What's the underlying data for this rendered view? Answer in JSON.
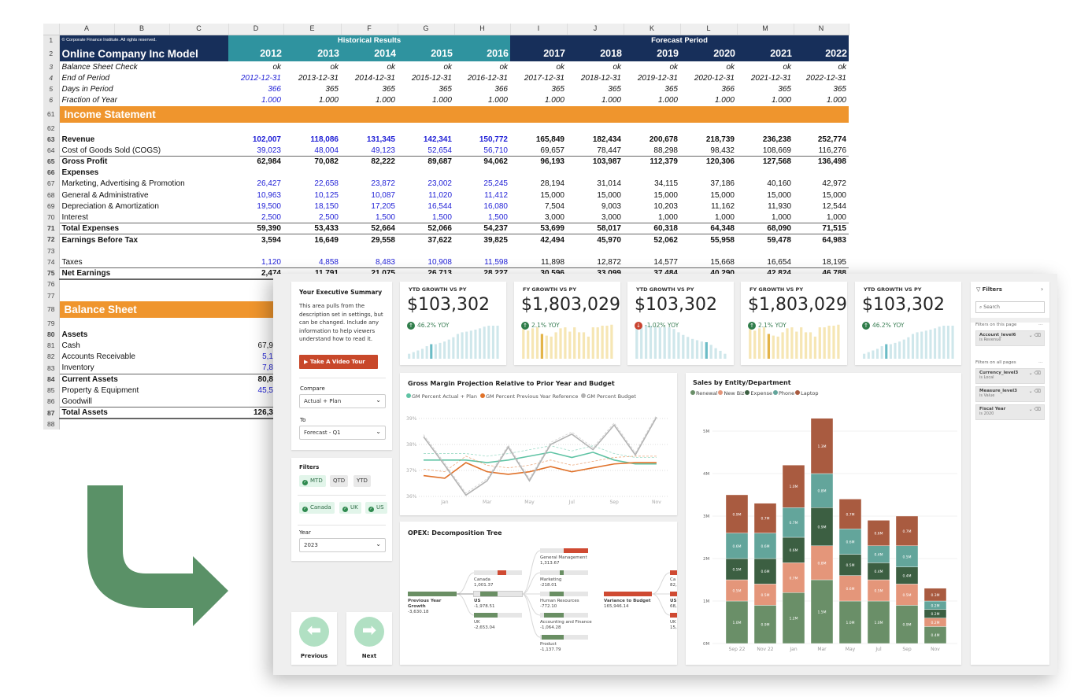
{
  "sheet": {
    "columns": [
      "A",
      "B",
      "C",
      "D",
      "E",
      "F",
      "G",
      "H",
      "I",
      "J",
      "K",
      "L",
      "M",
      "N"
    ],
    "copyright": "© Corporate Finance Institute. All rights reserved.",
    "title": "Online Company Inc Model",
    "historical_label": "Historical Results",
    "forecast_label": "Forecast Period",
    "years": [
      "2012",
      "2013",
      "2014",
      "2015",
      "2016",
      "2017",
      "2018",
      "2019",
      "2020",
      "2021",
      "2022"
    ],
    "rows": [
      {
        "num": "3",
        "label": "Balance Sheet Check",
        "style": "ital",
        "values": [
          "ok",
          "ok",
          "ok",
          "ok",
          "ok",
          "ok",
          "ok",
          "ok",
          "ok",
          "ok",
          "ok"
        ]
      },
      {
        "num": "4",
        "label": "End of Period",
        "style": "ital",
        "blue_first": true,
        "values": [
          "2012-12-31",
          "2013-12-31",
          "2014-12-31",
          "2015-12-31",
          "2016-12-31",
          "2017-12-31",
          "2018-12-31",
          "2019-12-31",
          "2020-12-31",
          "2021-12-31",
          "2022-12-31"
        ]
      },
      {
        "num": "5",
        "label": "Days in Period",
        "style": "ital",
        "blue_first": true,
        "values": [
          "366",
          "365",
          "365",
          "365",
          "366",
          "365",
          "365",
          "365",
          "366",
          "365",
          "365"
        ]
      },
      {
        "num": "6",
        "label": "Fraction of Year",
        "style": "ital",
        "blue_first": true,
        "values": [
          "1.000",
          "1.000",
          "1.000",
          "1.000",
          "1.000",
          "1.000",
          "1.000",
          "1.000",
          "1.000",
          "1.000",
          "1.000"
        ]
      },
      {
        "num": "61",
        "label": "Income Statement",
        "style": "orange",
        "values": []
      },
      {
        "num": "62",
        "label": "",
        "values": []
      },
      {
        "num": "63",
        "label": "Revenue",
        "style": "bold",
        "blue_hist": true,
        "values": [
          "102,007",
          "118,086",
          "131,345",
          "142,341",
          "150,772",
          "165,849",
          "182,434",
          "200,678",
          "218,739",
          "236,238",
          "252,774"
        ]
      },
      {
        "num": "64",
        "label": "Cost of Goods Sold (COGS)",
        "blue_hist": true,
        "values": [
          "39,023",
          "48,004",
          "49,123",
          "52,654",
          "56,710",
          "69,657",
          "78,447",
          "88,298",
          "98,432",
          "108,669",
          "116,276"
        ]
      },
      {
        "num": "65",
        "label": "Gross Profit",
        "style": "bold topb",
        "values": [
          "62,984",
          "70,082",
          "82,222",
          "89,687",
          "94,062",
          "96,193",
          "103,987",
          "112,379",
          "120,306",
          "127,568",
          "136,498"
        ]
      },
      {
        "num": "66",
        "label": "Expenses",
        "style": "bold",
        "values": []
      },
      {
        "num": "67",
        "label": "Marketing, Advertising & Promotion",
        "blue_hist": true,
        "values": [
          "26,427",
          "22,658",
          "23,872",
          "23,002",
          "25,245",
          "28,194",
          "31,014",
          "34,115",
          "37,186",
          "40,160",
          "42,972"
        ]
      },
      {
        "num": "68",
        "label": "General & Administrative",
        "blue_hist": true,
        "values": [
          "10,963",
          "10,125",
          "10,087",
          "11,020",
          "11,412",
          "15,000",
          "15,000",
          "15,000",
          "15,000",
          "15,000",
          "15,000"
        ]
      },
      {
        "num": "69",
        "label": "Depreciation & Amortization",
        "blue_hist": true,
        "values": [
          "19,500",
          "18,150",
          "17,205",
          "16,544",
          "16,080",
          "7,504",
          "9,003",
          "10,203",
          "11,162",
          "11,930",
          "12,544"
        ]
      },
      {
        "num": "70",
        "label": "Interest",
        "blue_hist": true,
        "values": [
          "2,500",
          "2,500",
          "1,500",
          "1,500",
          "1,500",
          "3,000",
          "3,000",
          "1,000",
          "1,000",
          "1,000",
          "1,000"
        ]
      },
      {
        "num": "71",
        "label": "Total Expenses",
        "style": "bold topb",
        "values": [
          "59,390",
          "53,433",
          "52,664",
          "52,066",
          "54,237",
          "53,699",
          "58,017",
          "60,318",
          "64,348",
          "68,090",
          "71,515"
        ]
      },
      {
        "num": "72",
        "label": "Earnings Before Tax",
        "style": "bold topb",
        "values": [
          "3,594",
          "16,649",
          "29,558",
          "37,622",
          "39,825",
          "42,494",
          "45,970",
          "52,062",
          "55,958",
          "59,478",
          "64,983"
        ]
      },
      {
        "num": "73",
        "label": "",
        "values": []
      },
      {
        "num": "74",
        "label": "Taxes",
        "blue_hist": true,
        "values": [
          "1,120",
          "4,858",
          "8,483",
          "10,908",
          "11,598",
          "11,898",
          "12,872",
          "14,577",
          "15,668",
          "16,654",
          "18,195"
        ]
      },
      {
        "num": "75",
        "label": "Net Earnings",
        "style": "bold topb botb",
        "values": [
          "2,474",
          "11,791",
          "21,075",
          "26,713",
          "28,227",
          "30,596",
          "33,099",
          "37,484",
          "40,290",
          "42,824",
          "46,788"
        ]
      },
      {
        "num": "76",
        "label": "",
        "values": []
      },
      {
        "num": "77",
        "label": "",
        "values": []
      },
      {
        "num": "78",
        "label": "Balance Sheet",
        "style": "orange",
        "values": []
      },
      {
        "num": "79",
        "label": "",
        "values": []
      },
      {
        "num": "80",
        "label": "Assets",
        "style": "bold",
        "values": []
      },
      {
        "num": "81",
        "label": "Cash",
        "values": [
          "67,9"
        ]
      },
      {
        "num": "82",
        "label": "Accounts Receivable",
        "blue_first": true,
        "values": [
          "5,1"
        ]
      },
      {
        "num": "83",
        "label": "Inventory",
        "blue_first": true,
        "values": [
          "7,8"
        ]
      },
      {
        "num": "84",
        "label": "Current Assets",
        "style": "bold topb",
        "values": [
          "80,8"
        ]
      },
      {
        "num": "85",
        "label": "Property & Equipment",
        "blue_first": true,
        "values": [
          "45,5"
        ]
      },
      {
        "num": "86",
        "label": "Goodwill",
        "values": []
      },
      {
        "num": "87",
        "label": "Total Assets",
        "style": "bold topb botb",
        "values": [
          "126,3"
        ]
      },
      {
        "num": "88",
        "label": "",
        "values": []
      }
    ]
  },
  "arrow_color": "#5a9167",
  "summary": {
    "title": "Your Executive Summary",
    "description": "This area pulls from the description set in settings, but can be changed. Include any information to help viewers understand how to read it.",
    "tour_button": "Take A Video Tour",
    "compare_label": "Compare",
    "compare_value": "Actual + Plan",
    "to_label": "To",
    "to_value": "Forecast - Q1"
  },
  "filters_card": {
    "title": "Filters",
    "periods": [
      {
        "label": "MTD",
        "on": true
      },
      {
        "label": "QTD",
        "on": false
      },
      {
        "label": "YTD",
        "on": false
      }
    ],
    "regions": [
      {
        "label": "Canada",
        "on": true
      },
      {
        "label": "UK",
        "on": true
      },
      {
        "label": "US",
        "on": true
      }
    ],
    "year_label": "Year",
    "year_value": "2023"
  },
  "nav": {
    "previous": "Previous",
    "next": "Next"
  },
  "kpis": [
    {
      "title": "YTD GROWTH VS PY",
      "value": "$103,302",
      "yoy": "46.2% YOY",
      "trend": "up",
      "color": "teal",
      "highlight": 5,
      "sparkline": [
        0.15,
        0.2,
        0.25,
        0.3,
        0.38,
        0.44,
        0.44,
        0.48,
        0.52,
        0.58,
        0.65,
        0.75,
        0.8,
        0.82,
        0.85,
        0.88,
        0.92,
        0.97,
        1,
        1,
        1
      ]
    },
    {
      "title": "FY GROWTH VS PY",
      "value": "$1,803,029",
      "yoy": "2.1% YOY",
      "trend": "up",
      "color": "yellow",
      "highlight": 4,
      "sparkline": [
        0.9,
        0.85,
        0.92,
        0.95,
        0.75,
        0.7,
        0.67,
        0.8,
        0.92,
        0.95,
        0.82,
        0.95,
        0.8,
        0.8,
        0.67,
        0.95,
        0.95,
        1,
        1,
        1.03
      ]
    },
    {
      "title": "YTD GROWTH VS PY",
      "value": "$103,302",
      "yoy": "-1.02% YOY",
      "trend": "down",
      "color": "teal",
      "highlight": 15,
      "sparkline": [
        1,
        1,
        1,
        1,
        0.95,
        0.95,
        0.95,
        0.95,
        0.9,
        0.8,
        0.72,
        0.66,
        0.6,
        0.56,
        0.52,
        0.5,
        0.42,
        0.32,
        0.24,
        0.15
      ]
    },
    {
      "title": "FY GROWTH VS PY",
      "value": "$1,803,029",
      "yoy": "2.1% YOY",
      "trend": "up",
      "color": "yellow",
      "highlight": 4,
      "sparkline": [
        0.9,
        0.85,
        0.92,
        0.95,
        0.75,
        0.7,
        0.67,
        0.8,
        0.92,
        0.95,
        0.82,
        0.95,
        0.8,
        0.8,
        0.67,
        0.95,
        0.95,
        1,
        1,
        1.03
      ]
    },
    {
      "title": "YTD GROWTH VS PY",
      "value": "$103,302",
      "yoy": "46.2% YOY",
      "trend": "up",
      "color": "teal",
      "highlight": 5,
      "sparkline": [
        0.15,
        0.2,
        0.25,
        0.3,
        0.38,
        0.44,
        0.44,
        0.48,
        0.52,
        0.58,
        0.65,
        0.75,
        0.8,
        0.82,
        0.85,
        0.88,
        0.92,
        0.97,
        1,
        1,
        1
      ]
    }
  ],
  "colors": {
    "up": "#2f7d4a",
    "down": "#c9432f",
    "teal": "#cfe7eb",
    "teal_hi": "#6bbcc6",
    "yellow": "#f6e6b4",
    "yellow_hi": "#e3b449"
  },
  "chart_data": [
    {
      "type": "line",
      "title": "Gross Margin Projection Relative to Prior Year and Budget",
      "x_tick_labels": [
        "Jan",
        "Mar",
        "May",
        "Jul",
        "Sep",
        "Nov"
      ],
      "y_tick_labels": [
        "36%",
        "37%",
        "38%",
        "39%"
      ],
      "ylim": [
        36,
        39
      ],
      "grid": true,
      "legend": "top-left",
      "series": [
        {
          "name": "GM Percent Actual + Plan",
          "color": "#5fc3a4",
          "values": [
            37.4,
            37.4,
            37.4,
            37.3,
            37.4,
            37.55,
            37.7,
            37.5,
            37.7,
            37.4,
            37.25,
            37.25
          ]
        },
        {
          "name": "GM Percent Previous Year Reference",
          "color": "#e0722a",
          "values": [
            36.8,
            36.7,
            37.3,
            36.95,
            36.85,
            36.95,
            37.15,
            36.95,
            37.1,
            37.25,
            37.3,
            37.3
          ]
        },
        {
          "name": "GM Percent Budget",
          "color": "#b3b3b3",
          "values": [
            38.3,
            37.2,
            36.05,
            36.6,
            37.9,
            36.6,
            38.0,
            38.4,
            37.8,
            38.75,
            37.6,
            39.05
          ]
        }
      ]
    },
    {
      "type": "bar",
      "stacked": true,
      "title": "Sales by Entity/Department",
      "categories": [
        "Sep 22",
        "Nov 22",
        "Jan",
        "Mar",
        "May",
        "Jul",
        "Sep",
        "Nov"
      ],
      "y_tick_labels": [
        "0M",
        "1M",
        "2M",
        "3M",
        "4M",
        "5M"
      ],
      "ylim": [
        0,
        5.5
      ],
      "legend": "top-left",
      "series": [
        {
          "name": "Renewal",
          "color": "#6a8f68",
          "values": [
            1.0,
            0.9,
            1.2,
            1.5,
            1.0,
            1.0,
            0.9,
            0.4
          ]
        },
        {
          "name": "New Biz",
          "color": "#e4967a",
          "values": [
            0.5,
            0.5,
            0.7,
            0.8,
            0.6,
            0.5,
            0.5,
            0.2
          ]
        },
        {
          "name": "Expense",
          "color": "#3c5f42",
          "values": [
            0.5,
            0.6,
            0.6,
            0.9,
            0.5,
            0.4,
            0.4,
            0.2
          ]
        },
        {
          "name": "Phone",
          "color": "#63a59b",
          "values": [
            0.6,
            0.6,
            0.7,
            0.8,
            0.6,
            0.4,
            0.5,
            0.2
          ]
        },
        {
          "name": "Laptop",
          "color": "#a95b40",
          "values": [
            0.9,
            0.7,
            1.0,
            1.3,
            0.7,
            0.6,
            0.7,
            0.3
          ]
        }
      ]
    }
  ],
  "decomp": {
    "title": "OPEX: Decomposition Tree",
    "root": {
      "label": "Previous Year Growth",
      "value": "-3,630.18"
    },
    "level1": [
      {
        "label": "Canada",
        "value": "1,001.37"
      },
      {
        "label": "US",
        "value": "-1,978.51"
      },
      {
        "label": "UK",
        "value": "-2,653.04"
      }
    ],
    "level2": [
      {
        "label": "General Management",
        "value": "1,313.67"
      },
      {
        "label": "Marketing",
        "value": "-218.01"
      },
      {
        "label": "Human Resources",
        "value": "-772.10"
      },
      {
        "label": "Accounting and Finance",
        "value": "-1,064.28"
      },
      {
        "label": "Product",
        "value": "-1,137.79"
      }
    ],
    "variance": {
      "label": "Variance to Budget",
      "value": "165,946.14"
    },
    "level4": [
      {
        "label": "Ca",
        "value": "82,"
      },
      {
        "label": "US",
        "value": "68,"
      },
      {
        "label": "UK",
        "value": "15,"
      }
    ]
  },
  "filter_pane": {
    "title": "Filters",
    "search_placeholder": "Search",
    "this_page_label": "Filters on this page",
    "all_pages_label": "Filters on all pages",
    "more": "...",
    "this_page": [
      {
        "field": "Account_level6",
        "condition": "is Revenue"
      }
    ],
    "all_pages": [
      {
        "field": "Currency_level3",
        "condition": "is Local"
      },
      {
        "field": "Measure_level3",
        "condition": "is Value"
      },
      {
        "field": "Fiscal Year",
        "condition": "is 2020"
      }
    ]
  }
}
